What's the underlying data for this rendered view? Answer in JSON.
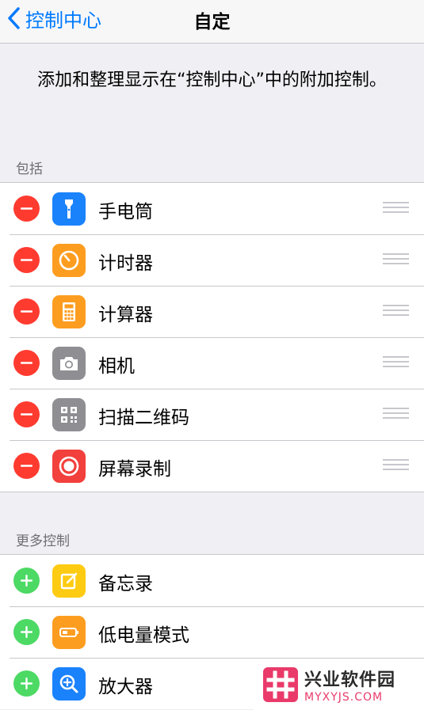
{
  "nav": {
    "back_label": "控制中心",
    "title": "自定"
  },
  "description": "添加和整理显示在“控制中心”中的附加控制。",
  "included": {
    "header": "包括",
    "items": [
      {
        "label": "手电筒",
        "icon": "flashlight-icon",
        "color": "#1a82fb"
      },
      {
        "label": "计时器",
        "icon": "timer-icon",
        "color": "#fd9d20"
      },
      {
        "label": "计算器",
        "icon": "calculator-icon",
        "color": "#fd9d20"
      },
      {
        "label": "相机",
        "icon": "camera-icon",
        "color": "#8e8e93"
      },
      {
        "label": "扫描二维码",
        "icon": "qr-code-icon",
        "color": "#8e8e93"
      },
      {
        "label": "屏幕录制",
        "icon": "screen-record-icon",
        "color": "#f2403c"
      }
    ]
  },
  "more": {
    "header": "更多控制",
    "items": [
      {
        "label": "备忘录",
        "icon": "notes-icon",
        "color": "#fdcb12"
      },
      {
        "label": "低电量模式",
        "icon": "low-power-icon",
        "color": "#fd9d20"
      },
      {
        "label": "放大器",
        "icon": "magnifier-icon",
        "color": "#1a82fb"
      }
    ]
  },
  "colors": {
    "remove": "#ff3b30",
    "add": "#4cd964",
    "accent": "#007aff"
  },
  "watermark": {
    "name": "兴业软件园",
    "domain": "MYXYJS.COM"
  }
}
